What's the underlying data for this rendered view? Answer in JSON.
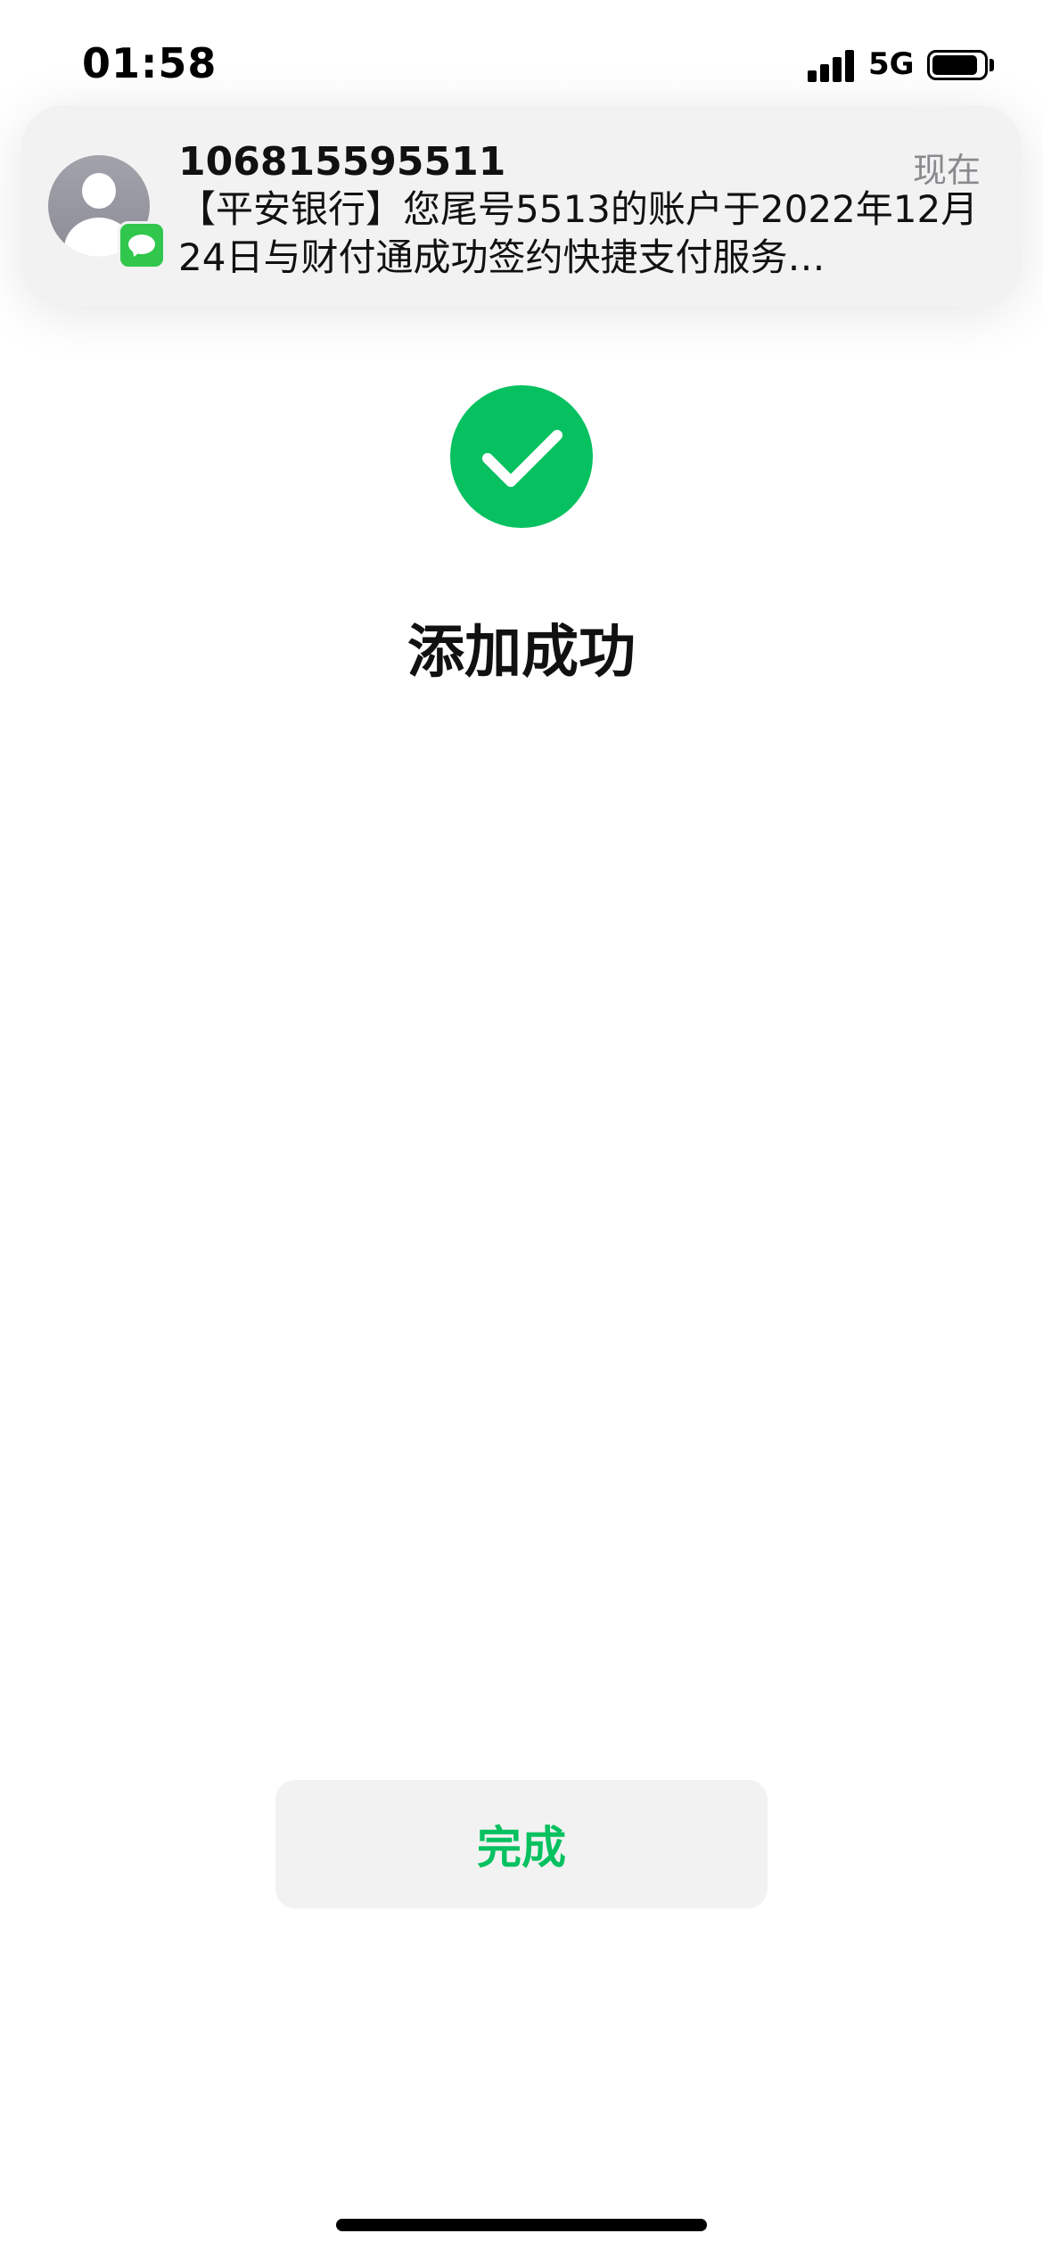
{
  "status_bar": {
    "time": "01:58",
    "network": "5G",
    "signal_bars": 4,
    "battery_level": 0.9
  },
  "notification": {
    "sender": "106815595511",
    "time": "现在",
    "message": "【平安银行】您尾号5513的账户于2022年12月24日与财付通成功签约快捷支付服务…",
    "app_icon": "messages-icon",
    "avatar_icon": "contact-avatar-icon"
  },
  "main": {
    "status_icon": "check-circle-icon",
    "title": "添加成功",
    "done_label": "完成"
  },
  "colors": {
    "accent": "#07c160",
    "notification_bg": "#f2f2f3",
    "button_bg": "#f2f2f2"
  }
}
